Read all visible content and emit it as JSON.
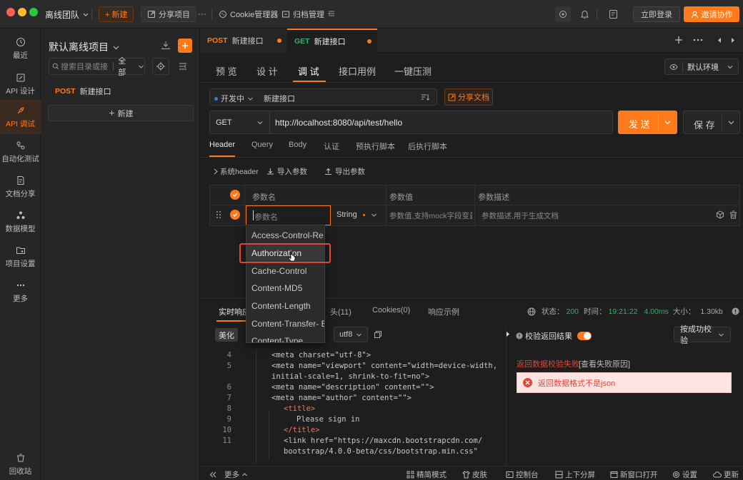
{
  "titlebar": {
    "team": "离线团队",
    "new_btn": "+ 新建",
    "share_project": "分享项目",
    "more": "···",
    "cookie_mgr": "Cookie管理器",
    "archive_mgr": "归档管理",
    "login": "立即登录",
    "invite": "邀请协作"
  },
  "left_nav": {
    "items": [
      {
        "label": "最近",
        "icon": "clock-icon"
      },
      {
        "label": "API 设计",
        "icon": "edit-icon"
      },
      {
        "label": "API 调试",
        "icon": "rocket-icon"
      },
      {
        "label": "自动化测试",
        "icon": "flow-icon"
      },
      {
        "label": "文档分享",
        "icon": "doc-icon"
      },
      {
        "label": "数据模型",
        "icon": "model-icon"
      },
      {
        "label": "项目设置",
        "icon": "folder-gear-icon"
      },
      {
        "label": "更多",
        "icon": "more-icon"
      }
    ],
    "trash": "回收站"
  },
  "project": {
    "name": "默认离线项目",
    "search_placeholder": "搜索目录或接",
    "filter": "全部",
    "tree_item_method": "POST",
    "tree_item_name": "新建接口",
    "new_btn": "新建"
  },
  "tabs": [
    {
      "method": "POST",
      "name": "新建接口"
    },
    {
      "method": "GET",
      "name": "新建接口"
    }
  ],
  "subnav": {
    "items": [
      "预 览",
      "设 计",
      "调 试",
      "接口用例",
      "一键压测"
    ],
    "env": "默认环境"
  },
  "request": {
    "status": "开发中",
    "name": "新建接口",
    "share_doc": "分享文档",
    "method": "GET",
    "url": "http://localhost:8080/api/test/hello",
    "send": "发 送",
    "save": "保 存"
  },
  "param_tabs": [
    "Header",
    "Query",
    "Body",
    "认证",
    "预执行脚本",
    "后执行脚本"
  ],
  "header_tools": {
    "system_header": "系统header",
    "import": "导入参数",
    "export": "导出参数"
  },
  "table": {
    "columns": [
      "参数名",
      "参数值",
      "参数描述"
    ],
    "row": {
      "name_placeholder": "参数名",
      "type": "String",
      "value_placeholder": "参数值,支持mock字段变量",
      "desc_placeholder": "参数描述,用于生成文档"
    }
  },
  "dropdown": {
    "items": [
      "Access-Control-Re",
      "Authorization",
      "Cache-Control",
      "Content-MD5",
      "Content-Length",
      "Content-Transfer- E",
      "Content-Type"
    ],
    "highlighted": "Authorization"
  },
  "response": {
    "tab_realtime": "实时响应",
    "tab_headers": "头(11)",
    "tab_cookies": "Cookies(0)",
    "tab_example": "响应示例",
    "status_label": "状态：",
    "status": "200",
    "time_label": "时间：",
    "time": "19:21:22",
    "duration": "4.00ms",
    "size_label": "大小：",
    "size": "1.30kb",
    "beautify": "美化",
    "encoding": "utf8",
    "validate_label": "校验返回结果",
    "validate_mode": "按成功校验",
    "fail_title": "返回数据校验失败",
    "fail_link": "[查看失败原因]",
    "error_msg": "返回数据格式不是json",
    "code_lines": [
      {
        "no": "4",
        "text": "<meta charset=\"utf-8\">"
      },
      {
        "no": "5",
        "text": "<meta name=\"viewport\" content=\"width=device-width,"
      },
      {
        "no": "",
        "text": "initial-scale=1, shrink-to-fit=no\">"
      },
      {
        "no": "6",
        "text": "<meta name=\"description\" content=\"\">"
      },
      {
        "no": "7",
        "text": "<meta name=\"author\" content=\"\">"
      },
      {
        "no": "8",
        "text": "<title>"
      },
      {
        "no": "9",
        "text": "Please sign in"
      },
      {
        "no": "10",
        "text": "</title>"
      },
      {
        "no": "11",
        "text": "<link href=\"https://maxcdn.bootstrapcdn.com/"
      },
      {
        "no": "",
        "text": "bootstrap/4.0.0-beta/css/bootstrap.min.css\""
      }
    ]
  },
  "bottom": {
    "more": "更多",
    "simple_mode": "精简模式",
    "skin": "皮肤",
    "console": "控制台",
    "split": "上下分屏",
    "new_window": "新窗口打开",
    "settings": "设置",
    "update": "更新"
  },
  "colors": {
    "accent": "#ff7a1a",
    "get": "#2fb36a",
    "error": "#e0453a"
  }
}
